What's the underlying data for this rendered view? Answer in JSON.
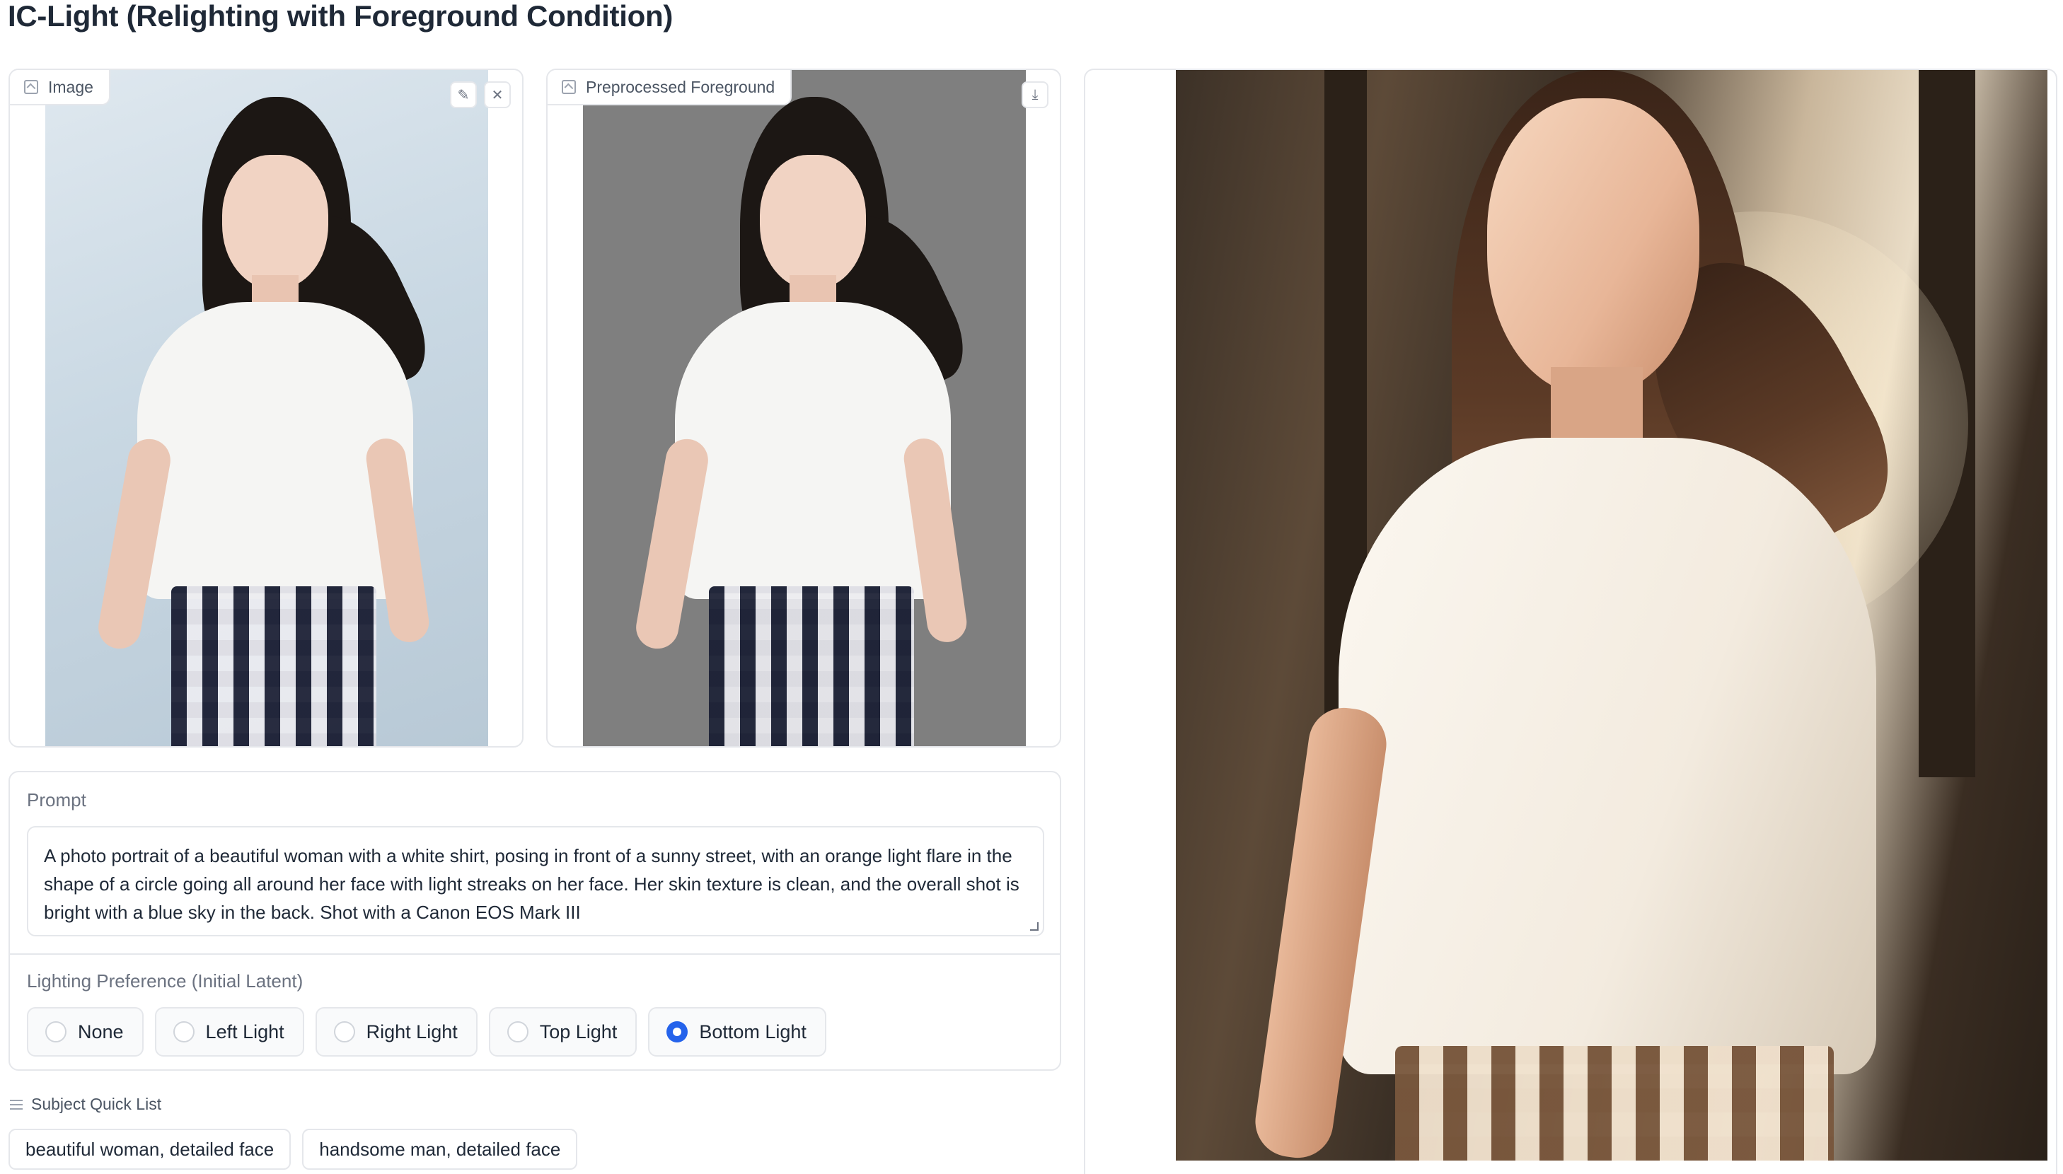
{
  "app": {
    "title": "IC-Light (Relighting with Foreground Condition)"
  },
  "input_image": {
    "label": "Image",
    "edit_icon": "pencil-icon",
    "close_icon": "close-icon",
    "image_icon": "image-icon"
  },
  "preprocessed": {
    "label": "Preprocessed Foreground",
    "download_icon": "download-icon",
    "image_icon": "image-icon"
  },
  "prompt": {
    "label": "Prompt",
    "value": "A photo portrait of a beautiful woman with a white shirt, posing in front of a sunny street, with an orange light flare in the shape of a circle going all around her face with light streaks on her face. Her skin texture is clean, and the overall shot is bright with a blue sky in the back. Shot with a Canon EOS Mark III"
  },
  "lighting": {
    "label": "Lighting Preference (Initial Latent)",
    "options": [
      "None",
      "Left Light",
      "Right Light",
      "Top Light",
      "Bottom Light"
    ],
    "selected": "Bottom Light",
    "accent": "#2563eb"
  },
  "quick_list": {
    "label": "Subject Quick List",
    "icon": "list-icon",
    "items": [
      "beautiful woman, detailed face",
      "handsome man, detailed face"
    ]
  }
}
